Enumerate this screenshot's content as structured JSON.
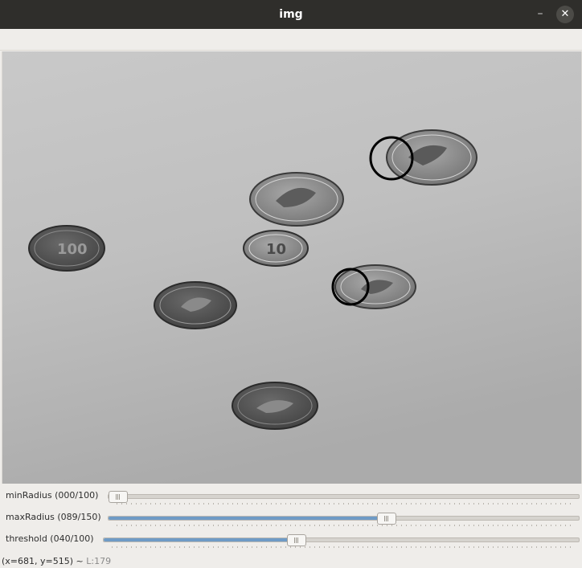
{
  "window": {
    "title": "img",
    "minimize_glyph": "–",
    "close_glyph": "✕"
  },
  "image": {
    "alt": "grayscale photo of coins with detected circles"
  },
  "sliders": [
    {
      "name": "minRadius",
      "label": "minRadius  (000/100)",
      "value": 0,
      "max": 100
    },
    {
      "name": "maxRadius",
      "label": "maxRadius  (089/150)",
      "value": 89,
      "max": 150
    },
    {
      "name": "threshold",
      "label": "threshold  (040/100)",
      "value": 40,
      "max": 100
    }
  ],
  "status": {
    "coords": "(x=681, y=515) ~",
    "pixel": "L:179"
  },
  "colors": {
    "titlebar": "#2f2e2b",
    "slider_fill": "#6f9bc6",
    "window_bg": "#efedea"
  }
}
